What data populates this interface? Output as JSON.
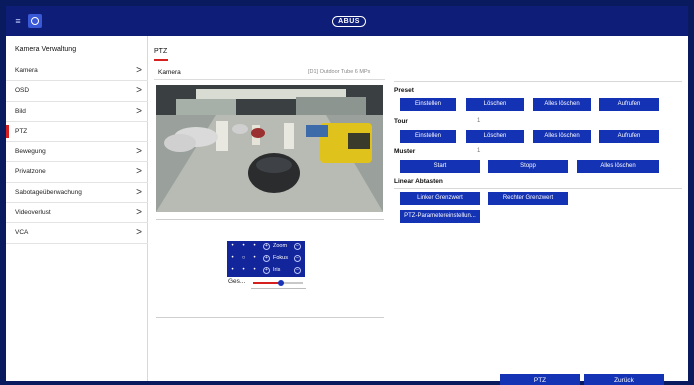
{
  "brand": {
    "logo_text": "ABUS"
  },
  "sidebar": {
    "title": "Kamera Verwaltung",
    "items": [
      {
        "label": "Kamera",
        "chevron": ">"
      },
      {
        "label": "OSD",
        "chevron": ">"
      },
      {
        "label": "Bild",
        "chevron": ">"
      },
      {
        "label": "PTZ",
        "chevron": "",
        "active": true
      },
      {
        "label": "Bewegung",
        "chevron": ">"
      },
      {
        "label": "Privatzone",
        "chevron": ">"
      },
      {
        "label": "Sabotageüberwachung",
        "chevron": ">"
      },
      {
        "label": "Videoverlust",
        "chevron": ">"
      },
      {
        "label": "VCA",
        "chevron": ">"
      }
    ]
  },
  "main": {
    "tab": "PTZ",
    "camera": {
      "label": "Kamera",
      "value": "[D1] Outdoor Tube 6 MPx"
    },
    "ptz_controls": {
      "directions": [
        "•",
        "•",
        "•",
        "•",
        "○",
        "•",
        "•",
        "•",
        "•"
      ],
      "zoom": "Zoom",
      "focus": "Fokus",
      "iris": "Iris",
      "plus": "+",
      "minus": "−"
    },
    "speed": {
      "label": "Ges...",
      "level": 0.55
    },
    "preset": {
      "title": "Preset",
      "buttons": [
        "Einstellen",
        "Löschen",
        "Alles löschen",
        "Aufrufen"
      ]
    },
    "tour": {
      "title": "Tour",
      "number": "1",
      "buttons": [
        "Einstellen",
        "Löschen",
        "Alles löschen",
        "Aufrufen"
      ]
    },
    "muster": {
      "title": "Muster",
      "number": "1",
      "buttons": [
        "Start",
        "Stopp",
        "Alles löschen"
      ]
    },
    "linear": {
      "title": "Linear Abtasten",
      "buttons": [
        "Linker Grenzwert",
        "Rechter Grenzwert"
      ]
    },
    "params_button": "PTZ-Parametereinstellun..."
  },
  "footer": {
    "ptz": "PTZ",
    "back": "Zurück"
  },
  "icons": {
    "menu": "menu-icon",
    "home": "home-icon",
    "chevron": "chevron-right-icon"
  },
  "colors": {
    "brand_blue": "#1432b4",
    "topbar": "#0e1e78",
    "accent_red": "#d62020"
  }
}
